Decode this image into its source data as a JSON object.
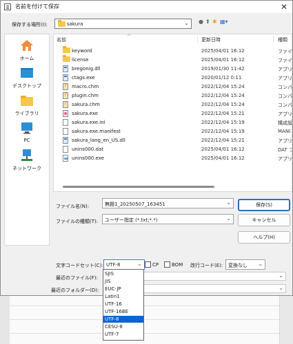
{
  "window": {
    "title": "名前を付けて保存"
  },
  "location": {
    "label": "保存する場所(I):",
    "current": "sakura"
  },
  "nav_icons": [
    "back-icon",
    "up-folder-icon",
    "new-folder-icon",
    "view-menu-icon"
  ],
  "places": [
    {
      "label": "ホーム",
      "icon": "home-icon"
    },
    {
      "label": "デスクトップ",
      "icon": "desktop-icon"
    },
    {
      "label": "ライブラリ",
      "icon": "library-icon"
    },
    {
      "label": "PC",
      "icon": "pc-icon"
    },
    {
      "label": "ネットワーク",
      "icon": "network-icon"
    }
  ],
  "columns": {
    "name": "名前",
    "date": "更新日時",
    "type": "種類"
  },
  "files": [
    {
      "name": "keyword",
      "date": "2025/04/01 16:12",
      "type": "ファイル",
      "icon": "folder"
    },
    {
      "name": "license",
      "date": "2025/04/01 16:12",
      "type": "ファイル",
      "icon": "folder"
    },
    {
      "name": "bregonig.dll",
      "date": "2019/01/30 11:42",
      "type": "アプリ",
      "icon": "ex"
    },
    {
      "name": "ctags.exe",
      "date": "2020/01/12 0:11",
      "type": "アプリ",
      "icon": "ex"
    },
    {
      "name": "macro.chm",
      "date": "2022/12/04 15:24",
      "type": "コンパ",
      "icon": "chm"
    },
    {
      "name": "plugin.chm",
      "date": "2022/12/04 15:24",
      "type": "コンパ",
      "icon": "chm"
    },
    {
      "name": "sakura.chm",
      "date": "2022/12/04 15:24",
      "type": "コンパ",
      "icon": "chm"
    },
    {
      "name": "sakura.exe",
      "date": "2022/12/04 15:21",
      "type": "アプリ",
      "icon": "sak"
    },
    {
      "name": "sakura.exe.ini",
      "date": "2022/12/04 15:19",
      "type": "構成設",
      "icon": "file"
    },
    {
      "name": "sakura.exe.manifest",
      "date": "2022/12/04 15:19",
      "type": "MANI",
      "icon": "file"
    },
    {
      "name": "sakura_lang_en_US.dll",
      "date": "2022/12/04 15:21",
      "type": "アプリ",
      "icon": "ex"
    },
    {
      "name": "unins000.dat",
      "date": "2025/04/01 16:12",
      "type": "DAT フ",
      "icon": "file"
    },
    {
      "name": "unins000.exe",
      "date": "2025/04/01 16:12",
      "type": "アプリ",
      "icon": "un"
    }
  ],
  "form": {
    "filename_label": "ファイル名(N):",
    "filename_value": "無題1_20250507_163451",
    "filetype_label": "ファイルの種類(T):",
    "filetype_value": "ユーザー指定 (*.txt;*.*)",
    "save_button": "保存(S)",
    "cancel_button": "キャンセル",
    "help_button": "ヘルプ(H)"
  },
  "encoding": {
    "label": "文字コードセット(C):",
    "selected": "UTF-8",
    "cp_label": "CP",
    "bom_label": "BOM",
    "eol_label": "改行コード(E):",
    "eol_value": "変換なし",
    "options": [
      "SJIS",
      "JIS",
      "EUC-JP",
      "Latin1",
      "UTF-16",
      "UTF-16BE",
      "UTF-8",
      "CESU-8",
      "UTF-7"
    ],
    "highlighted": "UTF-8"
  },
  "recent": {
    "file_label": "最近のファイル(F):",
    "folder_label": "最近のフォルダー(D):"
  },
  "colors": {
    "accent": "#0a64d4",
    "default_button_border": "#2f6fb8"
  }
}
